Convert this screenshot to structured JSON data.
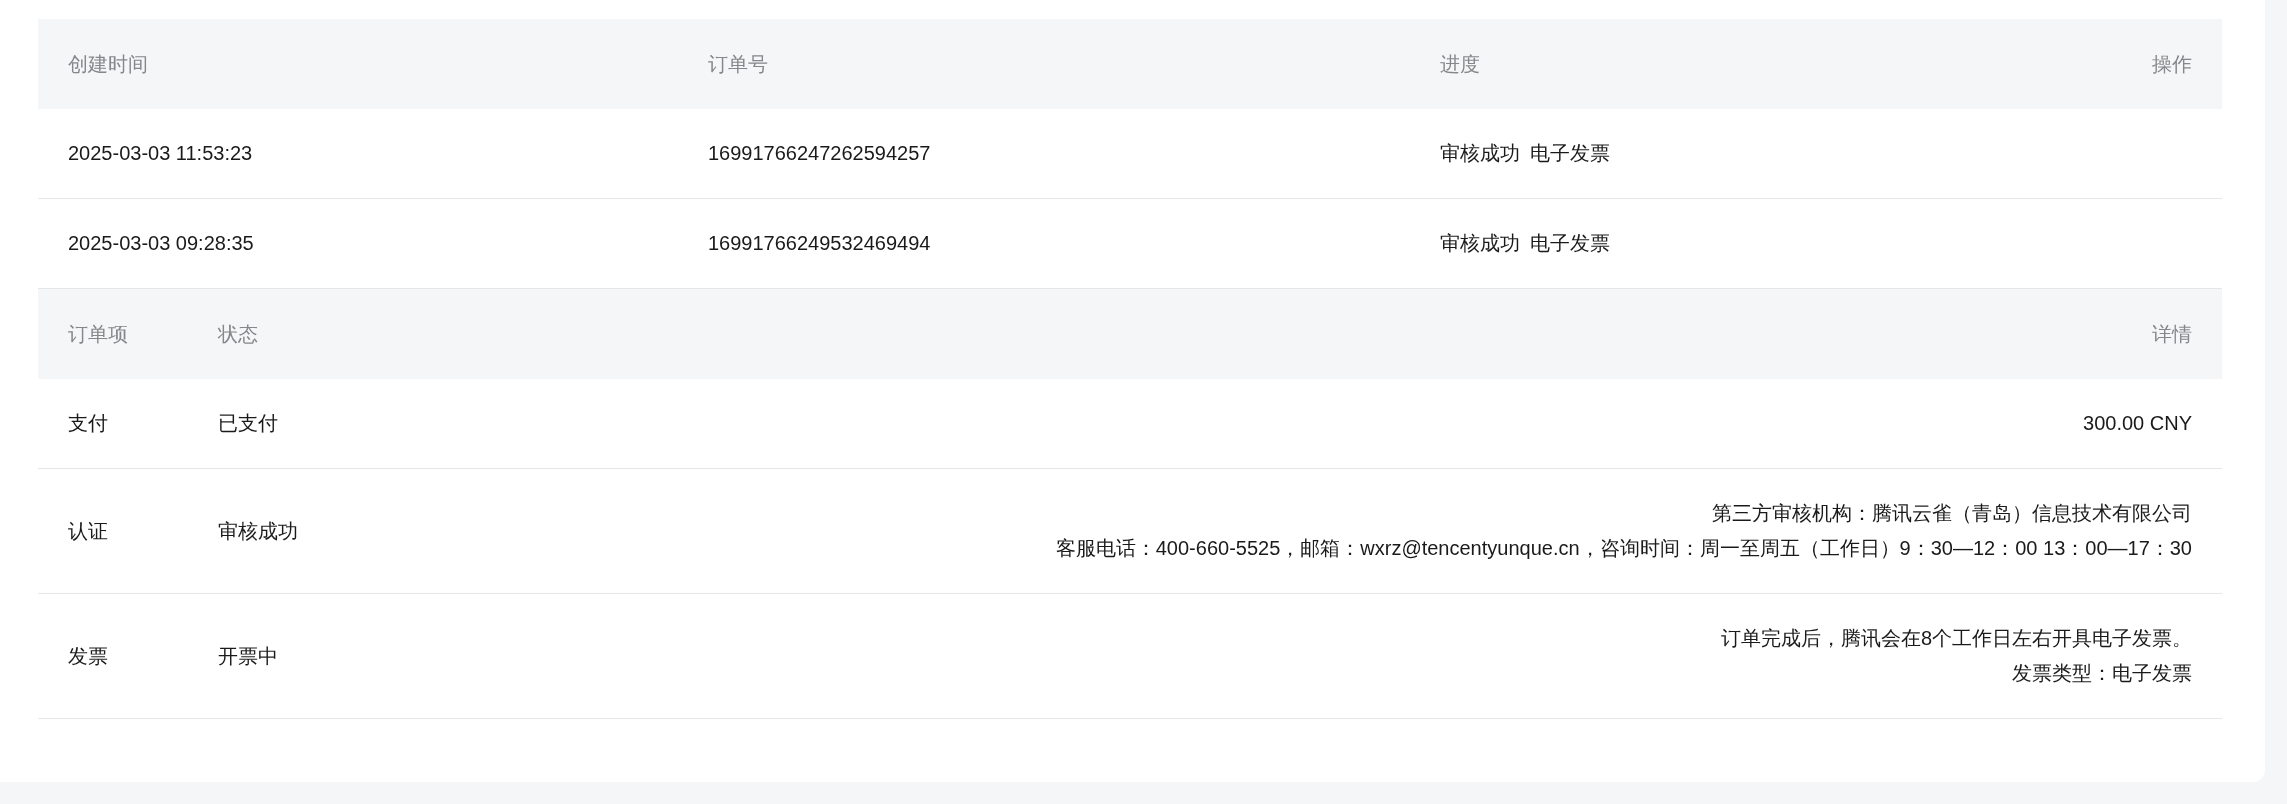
{
  "orders_table": {
    "columns": [
      "创建时间",
      "订单号",
      "进度",
      "操作"
    ],
    "rows": [
      {
        "created_at": "2025-03-03 11:53:23",
        "order_number": "1699176624726259425​7",
        "progress": [
          "审核成功",
          "电子发票"
        ]
      },
      {
        "created_at": "2025-03-03 09:28:35",
        "order_number": "1699176624953246949​4",
        "progress": [
          "审核成功",
          "电子发票"
        ]
      }
    ]
  },
  "items_table": {
    "columns": [
      "订单项",
      "状态",
      "详情"
    ],
    "rows": [
      {
        "item": "支付",
        "status": "已支付",
        "details": [
          "300.00 CNY"
        ]
      },
      {
        "item": "认证",
        "status": "审核成功",
        "details": [
          "第三方审核机构：腾讯云雀（青岛）信息技术有限公司",
          "客服电话：400-660-5525，邮箱：wxrz@tencentyunque.cn，咨询时间：周一至周五（工作日）9：30—12：00 13：00—17：30"
        ]
      },
      {
        "item": "发票",
        "status": "开票中",
        "details": [
          "订单完成后，腾讯会在8个工作日左右开具电子发票。",
          "发票类型：电子发票"
        ]
      }
    ]
  }
}
